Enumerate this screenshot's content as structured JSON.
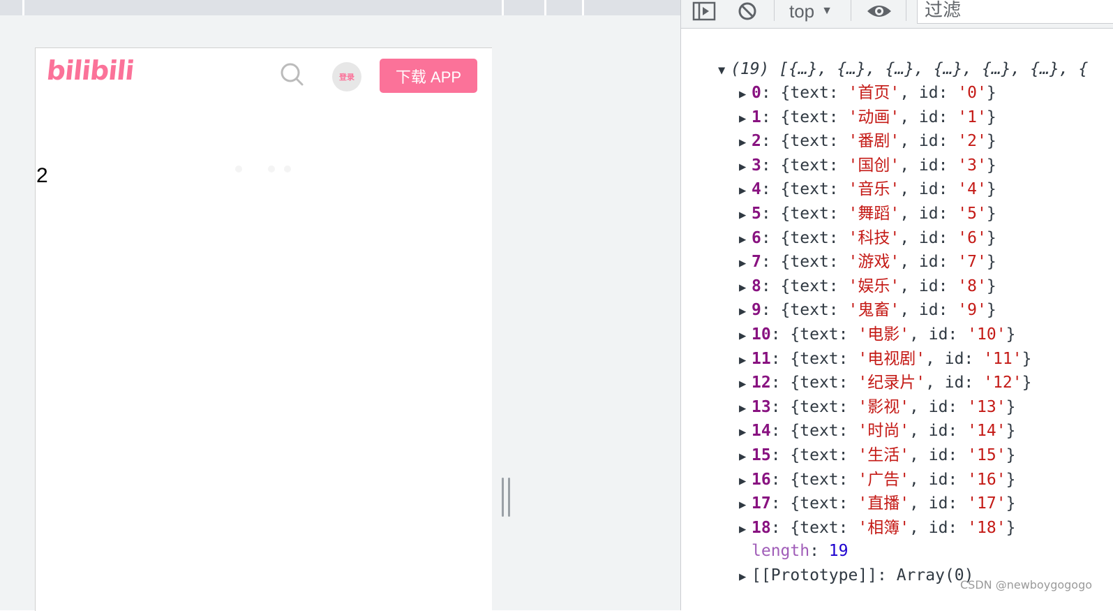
{
  "page": {
    "brand_logo": "bilibili",
    "search_icon": "search-icon",
    "login_label": "登录",
    "download_label": "下载 APP",
    "count_text": "2"
  },
  "devtools": {
    "context_label": "top",
    "caret": "▼",
    "filter_placeholder": "过滤",
    "array_summary": "(19) [{…}, {…}, {…}, {…}, {…}, {…}, {",
    "items": [
      {
        "index": "0",
        "text": "首页",
        "id": "0"
      },
      {
        "index": "1",
        "text": "动画",
        "id": "1"
      },
      {
        "index": "2",
        "text": "番剧",
        "id": "2"
      },
      {
        "index": "3",
        "text": "国创",
        "id": "3"
      },
      {
        "index": "4",
        "text": "音乐",
        "id": "4"
      },
      {
        "index": "5",
        "text": "舞蹈",
        "id": "5"
      },
      {
        "index": "6",
        "text": "科技",
        "id": "6"
      },
      {
        "index": "7",
        "text": "游戏",
        "id": "7"
      },
      {
        "index": "8",
        "text": "娱乐",
        "id": "8"
      },
      {
        "index": "9",
        "text": "鬼畜",
        "id": "9"
      },
      {
        "index": "10",
        "text": "电影",
        "id": "10"
      },
      {
        "index": "11",
        "text": "电视剧",
        "id": "11"
      },
      {
        "index": "12",
        "text": "纪录片",
        "id": "12"
      },
      {
        "index": "13",
        "text": "影视",
        "id": "13"
      },
      {
        "index": "14",
        "text": "时尚",
        "id": "14"
      },
      {
        "index": "15",
        "text": "生活",
        "id": "15"
      },
      {
        "index": "16",
        "text": "广告",
        "id": "16"
      },
      {
        "index": "17",
        "text": "直播",
        "id": "17"
      },
      {
        "index": "18",
        "text": "相簿",
        "id": "18"
      }
    ],
    "length_key": "length",
    "length_value": "19",
    "prototype_label": "[[Prototype]]",
    "prototype_value": "Array(0)"
  },
  "watermark": "CSDN @newboygogogo",
  "colors": {
    "accent": "#fb7299",
    "key": "#881280",
    "string": "#c41a16",
    "number": "#1c00cf"
  }
}
